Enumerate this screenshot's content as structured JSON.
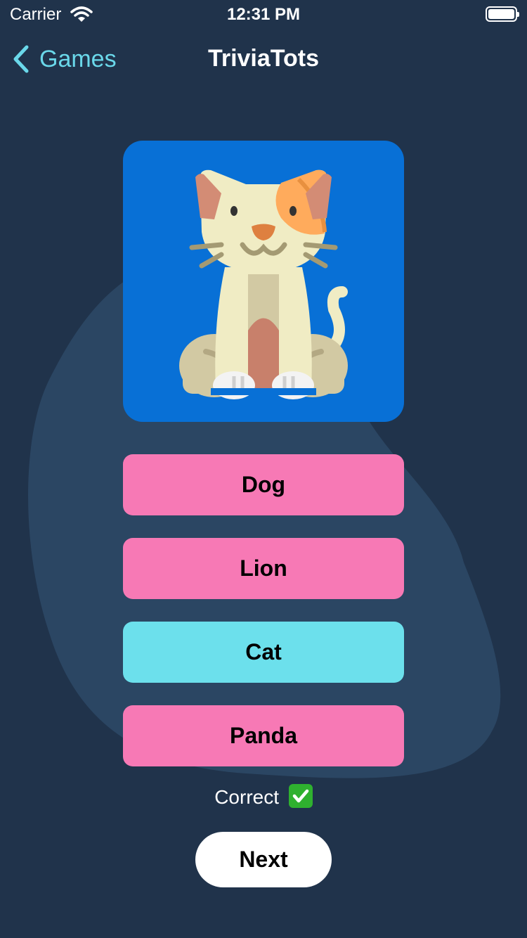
{
  "status_bar": {
    "carrier": "Carrier",
    "time": "12:31 PM",
    "icons": [
      "wifi-icon",
      "battery-icon"
    ]
  },
  "nav": {
    "back_label": "Games",
    "title": "TriviaTots",
    "back_icon": "chevron-left-icon"
  },
  "question": {
    "image_icon": "cat-illustration",
    "answers": [
      {
        "label": "Dog",
        "state": "incorrect",
        "color": "#f779b5"
      },
      {
        "label": "Lion",
        "state": "incorrect",
        "color": "#f779b5"
      },
      {
        "label": "Cat",
        "state": "correct",
        "color": "#6ce0ec"
      },
      {
        "label": "Panda",
        "state": "incorrect",
        "color": "#f779b5"
      }
    ]
  },
  "feedback": {
    "text": "Correct",
    "icon": "check-mark-icon"
  },
  "next_label": "Next",
  "colors": {
    "background": "#20334b",
    "blob": "#2b4663",
    "card": "#0870d6",
    "accent": "#6ad8ea",
    "wrong": "#f779b5",
    "right": "#6ce0ec"
  }
}
